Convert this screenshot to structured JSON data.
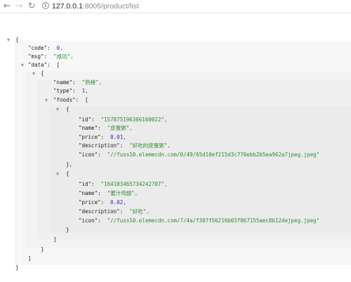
{
  "browser": {
    "back_icon": "arrow-left-icon",
    "forward_icon": "arrow-right-icon",
    "reload_icon": "reload-icon",
    "url_host": "127.0.0.1",
    "url_rest": ":8005/product/list"
  },
  "json": {
    "code_key": "\"code\":",
    "code_val": "0,",
    "msg_key": "\"msg\":",
    "msg_val": "\"成功\",",
    "data_key": "\"data\":",
    "name_key": "\"name\":",
    "name_val": "\"热榜\",",
    "type_key": "\"type\":",
    "type_val": "1,",
    "foods_key": "\"foods\":",
    "foods": [
      {
        "id_key": "\"id\":",
        "id_val": "\"157875196366160022\",",
        "name_key": "\"name\":",
        "name_val": "\"皮蛋粥\",",
        "price_key": "\"price\":",
        "price_val": "0.01,",
        "desc_key": "\"description\":",
        "desc_val": "\"好吃的皮蛋粥\",",
        "icon_key": "\"icon\":",
        "icon_val": "\"//fuss10.elemecdn.com/0/49/65d10ef215d3c770ebb2b5ea962a7jpeg.jpeg\""
      },
      {
        "id_key": "\"id\":",
        "id_val": "\"164103465734242707\",",
        "name_key": "\"name\":",
        "name_val": "\"蜜汁鸡翅\",",
        "price_key": "\"price\":",
        "price_val": "0.02,",
        "desc_key": "\"description\":",
        "desc_val": "\"好吃\",",
        "icon_key": "\"icon\":",
        "icon_val": "\"//fuss10.elemecdn.com/7/4a/f307f56216b03f067155aec8b124ejpeg.jpeg\""
      }
    ]
  }
}
